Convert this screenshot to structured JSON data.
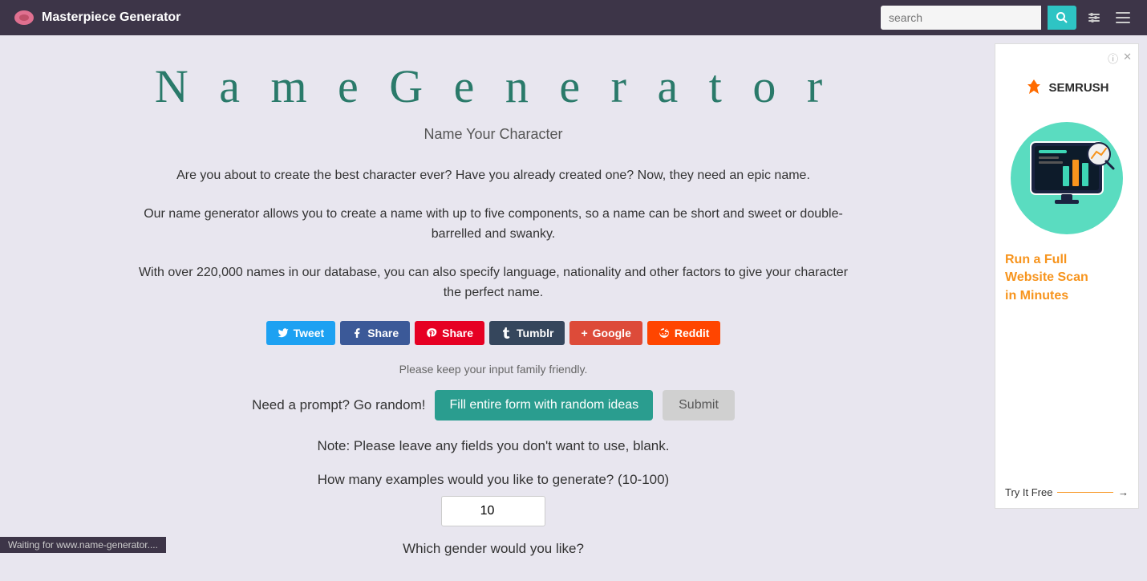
{
  "header": {
    "title": "Masterpiece Generator",
    "search_placeholder": "search",
    "search_label": "search"
  },
  "page": {
    "title": "N a m e   G e n e r a t o r",
    "subtitle": "Name Your Character",
    "description1": "Are you about to create the best character ever? Have you already created one? Now, they need an epic name.",
    "description2": "Our name generator allows you to create a name with up to five components, so a name can be short and sweet or double-barrelled and swanky.",
    "description3": "With over 220,000 names in our database, you can also specify language, nationality and other factors to give your character the perfect name.",
    "family_friendly": "Please keep your input family friendly.",
    "prompt_text": "Need a prompt? Go random!",
    "fill_random_label": "Fill entire form with random ideas",
    "submit_label": "Submit",
    "note": "Note: Please leave any fields you don't want to use, blank.",
    "examples_label": "How many examples would you like to generate? (10-100)",
    "examples_value": "10",
    "gender_hint": "Which gender would you like?"
  },
  "social": {
    "tweet": "Tweet",
    "share_fb": "Share",
    "share_pin": "Share",
    "tumblr": "Tumblr",
    "google": "Google",
    "reddit": "Reddit"
  },
  "ad": {
    "semrush": "SEMRUSH",
    "headline_line1": "Run a Full",
    "headline_line2": "Website Scan",
    "headline_line3": "in Minutes",
    "cta": "Try It Free"
  },
  "status": "Waiting for www.name-generator...."
}
